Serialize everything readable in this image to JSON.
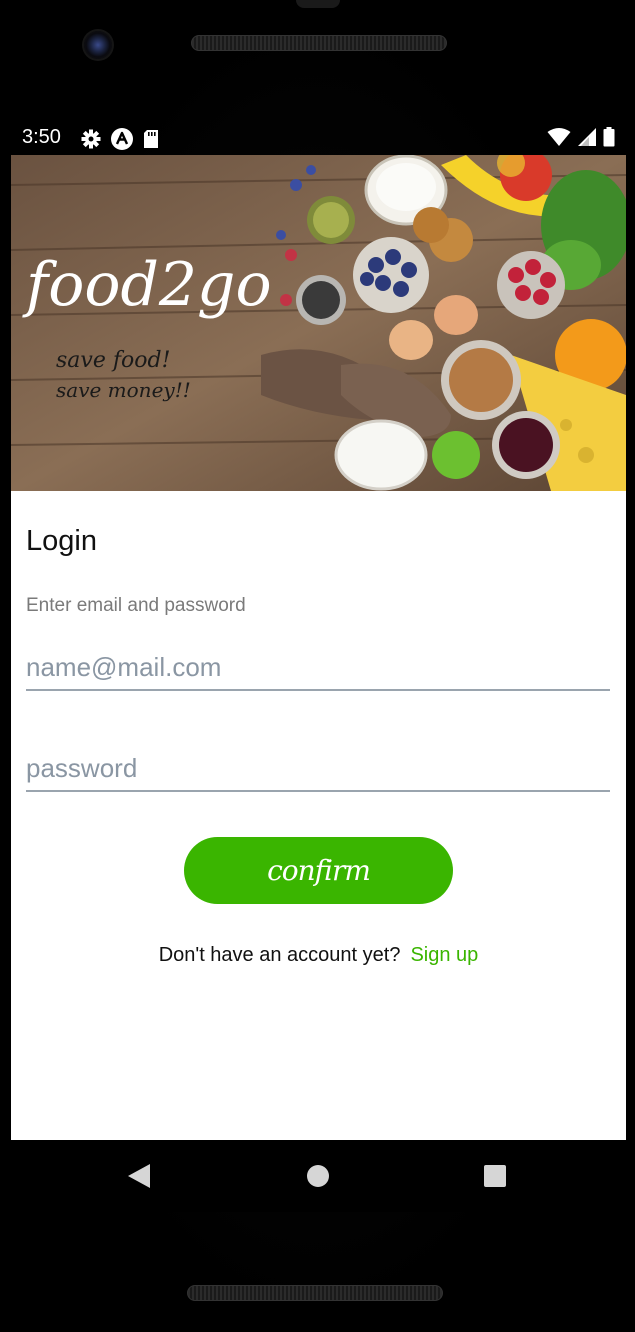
{
  "status_bar": {
    "time": "3:50",
    "left_icons": [
      "gear-icon",
      "app-logo-icon",
      "sd-card-icon"
    ],
    "right_icons": [
      "wifi-icon",
      "signal-icon",
      "battery-icon"
    ]
  },
  "hero": {
    "brand_name": "food2go",
    "tagline_line1": "save food!",
    "tagline_line2": "save money!!"
  },
  "login": {
    "title": "Login",
    "subtitle": "Enter email and password",
    "email_placeholder": "name@mail.com",
    "password_placeholder": "password",
    "confirm_label": "confirm",
    "signup_prompt": "Don't have an account yet?",
    "signup_link": "Sign up"
  },
  "colors": {
    "accent_green": "#3ab500",
    "hint_gray": "#7a7a7a",
    "underline": "#9aa4ae"
  },
  "nav_bar": {
    "icons": [
      "back-icon",
      "home-icon",
      "recents-icon"
    ]
  }
}
